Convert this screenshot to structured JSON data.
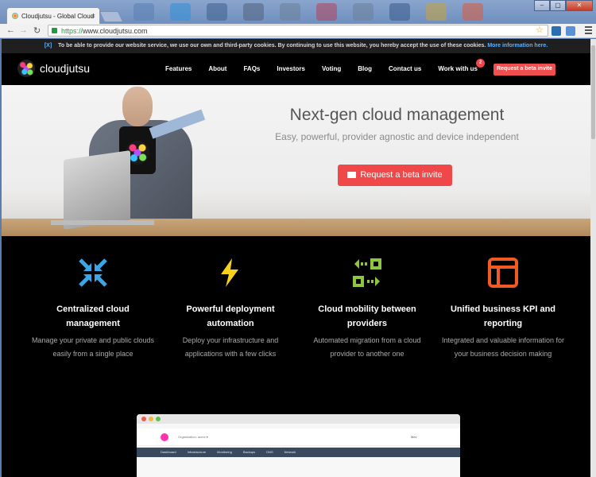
{
  "browser": {
    "tab_title": "Cloudjutsu - Global Cloud",
    "tab_close": "×",
    "url_scheme": "https://",
    "url_rest": "www.cloudjutsu.com",
    "back": "←",
    "forward": "→",
    "reload": "↻",
    "star": "☆",
    "win_min": "–",
    "win_max": "▢",
    "win_close": "✕"
  },
  "cookie_banner": {
    "close": "[X]",
    "text": "To be able to provide our website service, we use our own and third-party cookies. By continuing to use this website, you hereby accept the use of these cookies.",
    "more_link": "More information here."
  },
  "header": {
    "brand": "cloudjutsu",
    "nav": [
      "Features",
      "About",
      "FAQs",
      "Investors",
      "Voting",
      "Blog",
      "Contact us",
      "Work with us"
    ],
    "work_badge": "2",
    "cta": "Request a beta invite"
  },
  "hero": {
    "title": "Next-gen cloud management",
    "subtitle": "Easy, powerful, provider agnostic and device independent",
    "cta": "Request a beta invite"
  },
  "features": [
    {
      "icon": "compress-arrows-icon",
      "color": "#3aa6e8",
      "title": "Centralized cloud management",
      "desc": "Manage your private and public clouds easily from a single place"
    },
    {
      "icon": "lightning-bolt-icon",
      "color": "#f5d21b",
      "title": "Powerful deployment automation",
      "desc": "Deploy your infrastructure and applications with a few clicks"
    },
    {
      "icon": "mobility-arrows-icon",
      "color": "#8ec63f",
      "title": "Cloud mobility between providers",
      "desc": "Automated migration from a cloud provider to another one"
    },
    {
      "icon": "dashboard-layout-icon",
      "color": "#f05a23",
      "title": "Unified business KPI and reporting",
      "desc": "Integrated and valuable information for your business decision making"
    }
  ],
  "preview": {
    "org_label": "Organization: acme ▾",
    "user": "Mev",
    "nav": [
      "Dashboard",
      "Infrastructure",
      "Monitoring",
      "Backups",
      "DNS",
      "Network"
    ]
  }
}
